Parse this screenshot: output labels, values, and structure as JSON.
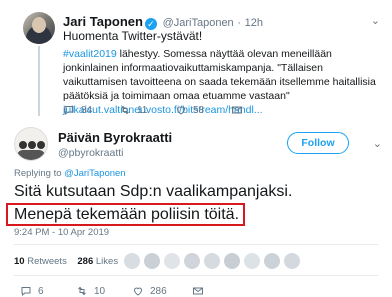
{
  "parent_tweet": {
    "author_name": "Jari Taponen",
    "author_handle": "@JariTaponen",
    "age": "12h",
    "greeting": "Huomenta Twitter-ystävät!",
    "hashtag": "#vaalit2019",
    "body_text": " lähestyy. Somessa näyttää olevan meneillään jonkinlainen informaatiovaikuttamiskampanja. \"Tällaisen vaikuttamisen tavoitteena on saada tekemään itsellemme haitallisia päätöksiä ja toimimaan omaa etuamme vastaan\"",
    "link_text": "julkaisut.valtioneuvosto.fi/bitstream/handl...",
    "replies": "84",
    "retweets": "11",
    "likes": "58"
  },
  "main_tweet": {
    "author_name": "Päivän Byrokraatti",
    "author_handle": "@pbyrokraatti",
    "follow_label": "Follow",
    "replying_prefix": "Replying to ",
    "replying_to": "@JariTaponen",
    "text_line1": "Sitä kutsutaan Sdp:n vaalikampanjaksi.",
    "text_line2": "Menepä tekemään poliisin töitä.",
    "timestamp": "9:24 PM - 10 Apr 2019",
    "retweet_count": "10",
    "retweet_label": " Retweets",
    "like_count": "286",
    "like_label": " Likes",
    "replies": "6",
    "retweets": "10",
    "likes": "286"
  },
  "colors": {
    "accent": "#1da1f2",
    "highlight_box": "#d7191d",
    "muted_text": "#657786"
  }
}
